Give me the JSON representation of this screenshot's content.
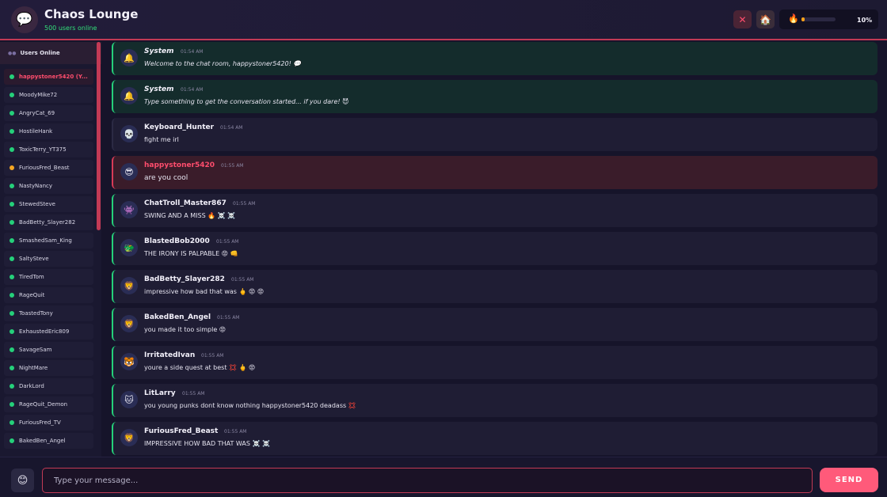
{
  "header": {
    "logo_icon": "💬",
    "title": "Chaos Lounge",
    "online": "500 users online",
    "close_icon": "✕",
    "home_icon": "🏠",
    "meter_icon": "🔥",
    "meter_fraction": 0.1,
    "meter_label": "10%"
  },
  "sidebar": {
    "title": "Users Online",
    "users": [
      {
        "name": "happystoner5420 (Y...",
        "status": "#25d07a"
      },
      {
        "name": "MoodyMike72",
        "status": "#25d07a"
      },
      {
        "name": "AngryCat_69",
        "status": "#25d07a"
      },
      {
        "name": "HostileHank",
        "status": "#25d07a"
      },
      {
        "name": "ToxicTerry_YT375",
        "status": "#25d07a"
      },
      {
        "name": "FuriousFred_Beast",
        "status": "#f5a623"
      },
      {
        "name": "NastyNancy",
        "status": "#25d07a"
      },
      {
        "name": "StewedSteve",
        "status": "#25d07a"
      },
      {
        "name": "BadBetty_Slayer282",
        "status": "#25d07a"
      },
      {
        "name": "SmashedSam_King",
        "status": "#25d07a"
      },
      {
        "name": "SaltySteve",
        "status": "#25d07a"
      },
      {
        "name": "TiredTom",
        "status": "#25d07a"
      },
      {
        "name": "RageQuit",
        "status": "#25d07a"
      },
      {
        "name": "ToastedTony",
        "status": "#25d07a"
      },
      {
        "name": "ExhaustedEric809",
        "status": "#25d07a"
      },
      {
        "name": "SavageSam",
        "status": "#25d07a"
      },
      {
        "name": "NightMare",
        "status": "#25d07a"
      },
      {
        "name": "DarkLord",
        "status": "#25d07a"
      },
      {
        "name": "RageQuit_Demon",
        "status": "#25d07a"
      },
      {
        "name": "FuriousFred_TV",
        "status": "#25d07a"
      },
      {
        "name": "BakedBen_Angel",
        "status": "#25d07a"
      }
    ]
  },
  "messages": [
    {
      "kind": "system",
      "avatar": "🔔",
      "user": "System",
      "time": "01:54 AM",
      "text": "Welcome to the chat room, happystoner5420! 💬"
    },
    {
      "kind": "system",
      "avatar": "🔔",
      "user": "System",
      "time": "01:54 AM",
      "text": "Type something to get the conversation started... if you dare! 😈"
    },
    {
      "kind": "neutral",
      "avatar": "💀",
      "user": "Keyboard_Hunter",
      "time": "01:54 AM",
      "text": "fight me irl"
    },
    {
      "kind": "self",
      "avatar": "😎",
      "user": "happystoner5420",
      "time": "01:55 AM",
      "text": "are you cool"
    },
    {
      "kind": "user",
      "avatar": "👾",
      "user": "ChatTroll_Master867",
      "time": "01:55 AM",
      "text": "SWING AND A MISS 🔥 ☠️ ☠️"
    },
    {
      "kind": "user",
      "avatar": "🐲",
      "user": "BlastedBob2000",
      "time": "01:55 AM",
      "text": "THE IRONY IS PALPABLE 😡 👊"
    },
    {
      "kind": "user",
      "avatar": "🦁",
      "user": "BadBetty_Slayer282",
      "time": "01:55 AM",
      "text": "impressive how bad that was 🖕 😡 😡"
    },
    {
      "kind": "user",
      "avatar": "🦁",
      "user": "BakedBen_Angel",
      "time": "01:55 AM",
      "text": "you made it too simple 😡"
    },
    {
      "kind": "user",
      "avatar": "🐯",
      "user": "IrritatedIvan",
      "time": "01:55 AM",
      "text": "youre a side quest at best 💢 🖕 😡"
    },
    {
      "kind": "user",
      "avatar": "🐱",
      "user": "LitLarry",
      "time": "01:55 AM",
      "text": "you young punks dont know nothing happystoner5420 deadass 💢"
    },
    {
      "kind": "user",
      "avatar": "🦁",
      "user": "FuriousFred_Beast",
      "time": "01:55 AM",
      "text": "IMPRESSIVE HOW BAD THAT WAS ☠️ ☠️"
    }
  ],
  "composer": {
    "emoji_icon": "😊",
    "placeholder": "Type your message...",
    "send_label": "SEND"
  }
}
